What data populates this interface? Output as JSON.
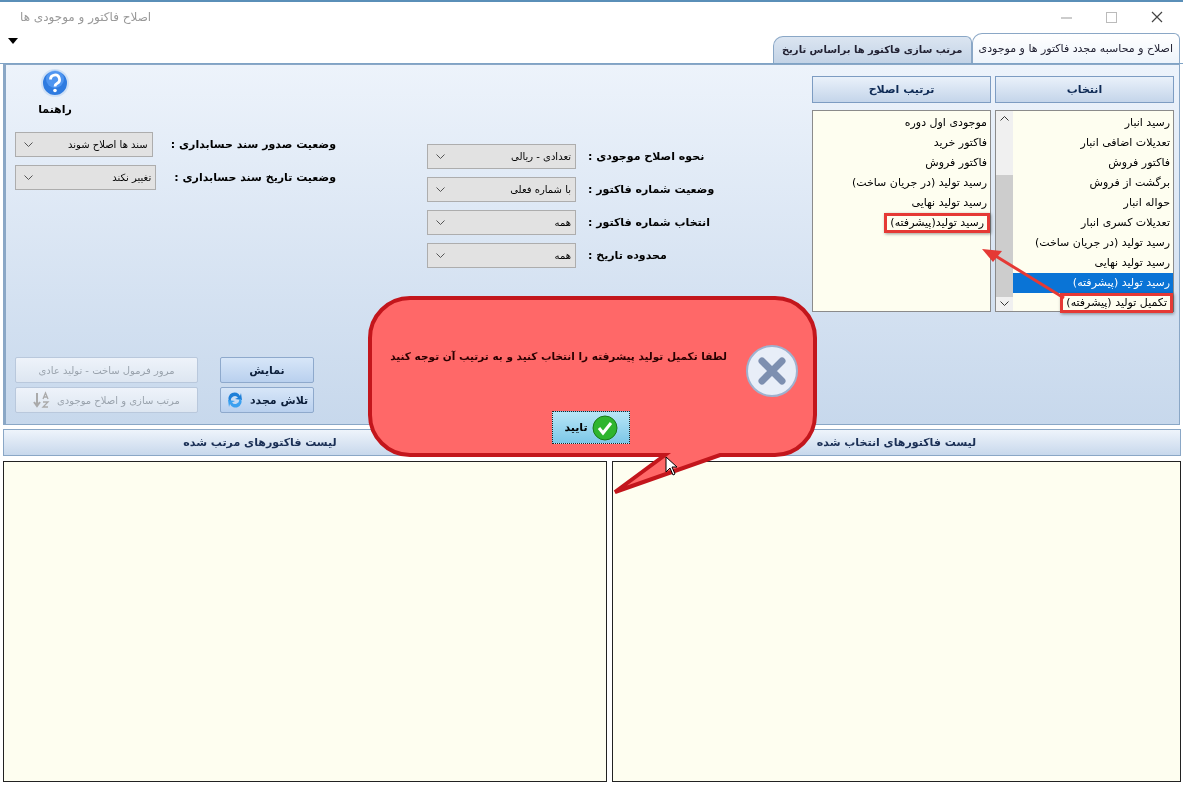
{
  "window": {
    "title": "اصلاح فاکتور و موجودی ها"
  },
  "tabs": [
    {
      "label": "اصلاح و محاسبه مجدد فاکتور ها و موجودی",
      "selected": true
    },
    {
      "label": "مرتب سازی فاکتور ها براساس تاریخ",
      "selected": false
    }
  ],
  "help": {
    "label": "راهنما"
  },
  "accounting_options": [
    {
      "label": "وضعیت صدور سند حسابداری :",
      "value": "سند ها اصلاح شوند"
    },
    {
      "label": "وضعیت تاریخ سند حسابداری :",
      "value": "تغییر نکند"
    }
  ],
  "correction_options": [
    {
      "label": "نحوه اصلاح موجودی :",
      "value": "تعدادی - ریالی"
    },
    {
      "label": "وضعیت شماره فاکتور :",
      "value": "با شماره فعلی"
    },
    {
      "label": "انتخاب شماره فاکتور :",
      "value": "همه"
    },
    {
      "label": "محدوده تاریخ :",
      "value": "همه"
    }
  ],
  "lists": [
    {
      "title": "انتخاب",
      "scrollable": true,
      "items": [
        {
          "label": "رسید انبار",
          "selected": false,
          "highlighted": false
        },
        {
          "label": "تعدیلات اضافی انبار",
          "selected": false,
          "highlighted": false
        },
        {
          "label": "فاکتور فروش",
          "selected": false,
          "highlighted": false
        },
        {
          "label": "برگشت از فروش",
          "selected": false,
          "highlighted": false
        },
        {
          "label": "حواله انبار",
          "selected": false,
          "highlighted": false
        },
        {
          "label": "تعدیلات کسری انبار",
          "selected": false,
          "highlighted": false
        },
        {
          "label": "رسید تولید (در جریان ساخت)",
          "selected": false,
          "highlighted": false
        },
        {
          "label": "رسید تولید نهایی",
          "selected": false,
          "highlighted": false
        },
        {
          "label": "رسید تولید (پیشرفته)",
          "selected": true,
          "highlighted": false
        },
        {
          "label": "تکمیل تولید (پیشرفته)",
          "selected": false,
          "highlighted": true
        }
      ]
    },
    {
      "title": "ترتیب اصلاح",
      "scrollable": false,
      "items": [
        {
          "label": "موجودی اول دوره",
          "selected": false,
          "highlighted": false
        },
        {
          "label": "فاکتور خرید",
          "selected": false,
          "highlighted": false
        },
        {
          "label": "فاکتور فروش",
          "selected": false,
          "highlighted": false
        },
        {
          "label": "رسید تولید (در جریان ساخت)",
          "selected": false,
          "highlighted": false
        },
        {
          "label": "رسید تولید نهایی",
          "selected": false,
          "highlighted": false
        },
        {
          "label": "رسید تولید(پیشرفته)",
          "selected": false,
          "highlighted": true
        }
      ]
    }
  ],
  "buttons": [
    {
      "label": "نمایش",
      "disabled": false,
      "kind": "plain"
    },
    {
      "label": "مرور فرمول ساخت - تولید عادی",
      "disabled": true,
      "kind": "plain"
    },
    {
      "label": "تلاش مجدد",
      "disabled": false,
      "kind": "retry"
    },
    {
      "label": "مرتب سازی و اصلاح موجودی",
      "disabled": true,
      "kind": "sort"
    }
  ],
  "bottom_lists": [
    {
      "title": "لیست فاکتورهای انتخاب شده"
    },
    {
      "title": "لیست فاکتورهای مرتب شده"
    }
  ],
  "message": {
    "text": "لطفا تکمیل تولید پیشرفته را انتخاب کنید و به ترتیب آن توجه کنید",
    "button": "تایید"
  }
}
